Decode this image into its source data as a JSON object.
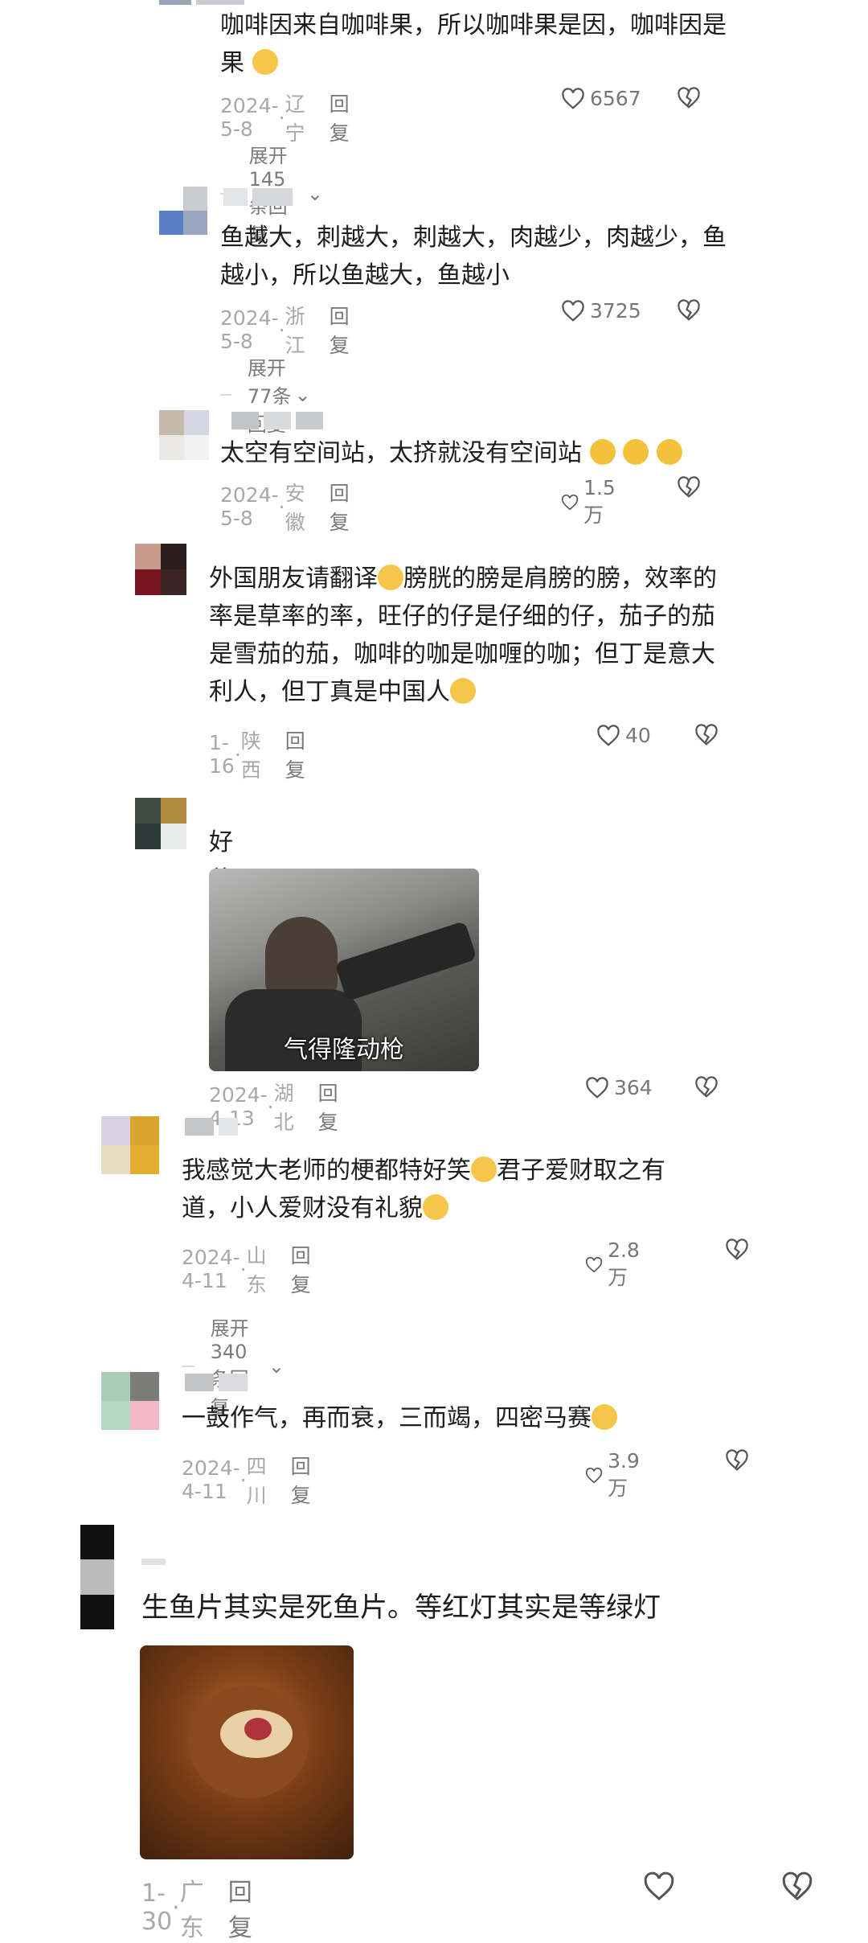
{
  "comments": [
    {
      "text_line1": "咖啡因来自咖啡果，所以咖啡果是因，咖啡因是",
      "text_line2": "果",
      "date": "2024-5-8",
      "region": "辽宁",
      "reply": "回复",
      "likes": "6567",
      "expand": "展开145条回复"
    },
    {
      "text_line1": "鱼越大，刺越大，刺越大，肉越少，肉越少，鱼",
      "text_line2": "越小，所以鱼越大，鱼越小",
      "date": "2024-5-8",
      "region": "浙江",
      "reply": "回复",
      "likes": "3725",
      "expand": "展开77条回复"
    },
    {
      "text_line1": "太空有空间站，太挤就没有空间站",
      "date": "2024-5-8",
      "region": "安徽",
      "reply": "回复",
      "likes": "1.5万"
    },
    {
      "text_line1": "外国朋友请翻译",
      "text_line1b": "膀胱的膀是肩膀的膀，效率的",
      "text_line2": "率是草率的率，旺仔的仔是仔细的仔，茄子的茄",
      "text_line3": "是雪茄的茄，咖啡的咖是咖喱的咖；但丁是意大",
      "text_line4": "利人，但丁真是中国人",
      "date": "1-16",
      "region": "陕西",
      "reply": "回复",
      "likes": "40"
    },
    {
      "text_line1": "好什金的图",
      "image_caption": "气得隆动枪",
      "date": "2024-4-13",
      "region": "湖北",
      "reply": "回复",
      "likes": "364"
    },
    {
      "text_line1": "我感觉大老师的梗都特好笑",
      "text_line1b": "君子爱财取之有",
      "text_line2": "道，小人爱财没有礼貌",
      "date": "2024-4-11",
      "region": "山东",
      "reply": "回复",
      "likes": "2.8万",
      "expand": "展开340条回复"
    },
    {
      "text_line1": "一鼓作气，再而衰，三而竭，四密马赛",
      "date": "2024-4-11",
      "region": "四川",
      "reply": "回复",
      "likes": "3.9万"
    },
    {
      "text_line1": "生鱼片其实是死鱼片。等红灯其实是等绿灯",
      "date": "1-30",
      "region": "广东",
      "reply": "回复"
    }
  ],
  "colors": {
    "text": "#1e1e1e",
    "meta": "#a8a8a8",
    "emoji": "#f6c64a"
  },
  "icons": {
    "like": "heart-outline-icon",
    "dislike": "broken-heart-icon",
    "expand": "chevron-down-icon"
  }
}
